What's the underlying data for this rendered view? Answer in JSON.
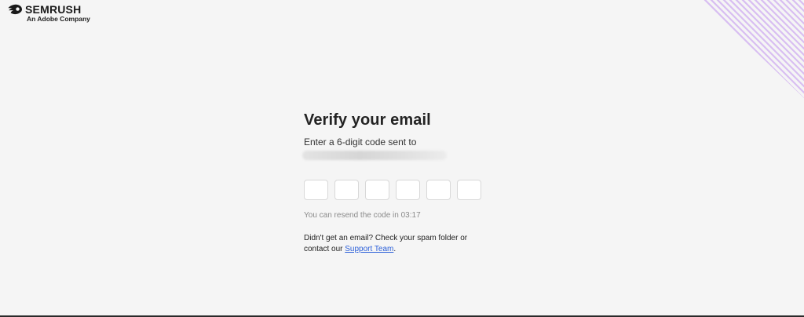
{
  "brand": {
    "name": "SEMRUSH",
    "tagline": "An Adobe Company",
    "accent_color": "#b27ce6"
  },
  "verify": {
    "title": "Verify your email",
    "subtitle": "Enter a 6-digit code sent to",
    "code_length": 6,
    "code_digits": [
      "",
      "",
      "",
      "",
      "",
      ""
    ],
    "resend_text": "You can resend the code in 03:17",
    "help_line1": "Didn't get an email? Check your spam folder or",
    "help_line2_prefix": "contact our",
    "support_link_label": "Support Team",
    "help_line2_suffix": "."
  }
}
